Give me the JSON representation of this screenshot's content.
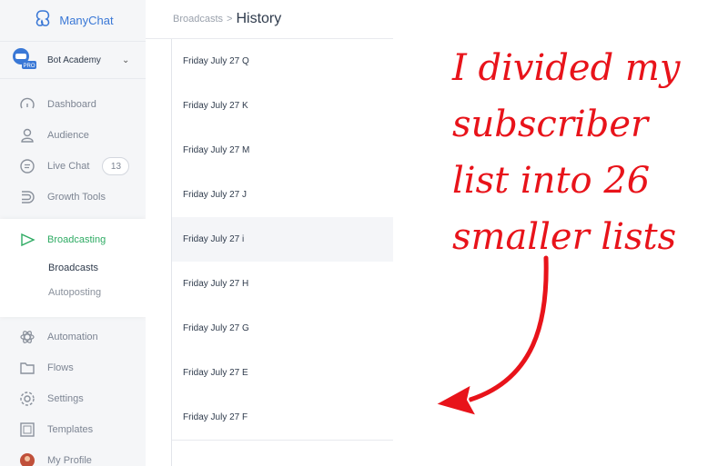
{
  "brand": {
    "name": "ManyChat"
  },
  "account": {
    "name": "Bot Academy",
    "badge": "PRO"
  },
  "nav": {
    "dashboard": "Dashboard",
    "audience": "Audience",
    "live_chat": "Live Chat",
    "live_chat_count": "13",
    "growth_tools": "Growth Tools",
    "broadcasting": "Broadcasting",
    "broadcasts": "Broadcasts",
    "autoposting": "Autoposting",
    "automation": "Automation",
    "flows": "Flows",
    "settings": "Settings",
    "templates": "Templates",
    "my_profile": "My Profile"
  },
  "header": {
    "breadcrumb": "Broadcasts",
    "separator": ">",
    "title": "History"
  },
  "rows": [
    "Friday July 27 Q",
    "Friday July 27 K",
    "Friday July 27 M",
    "Friday July 27 J",
    "Friday July 27 i",
    "Friday July 27 H",
    "Friday July 27 G",
    "Friday July 27 E",
    "Friday July 27 F"
  ],
  "annotation": {
    "lines": [
      "I divided my",
      "subscriber",
      "list into 26",
      "smaller lists"
    ]
  },
  "colors": {
    "accent_green": "#2eab63",
    "brand_blue": "#3a78d6",
    "annotation_red": "#e8131a"
  }
}
